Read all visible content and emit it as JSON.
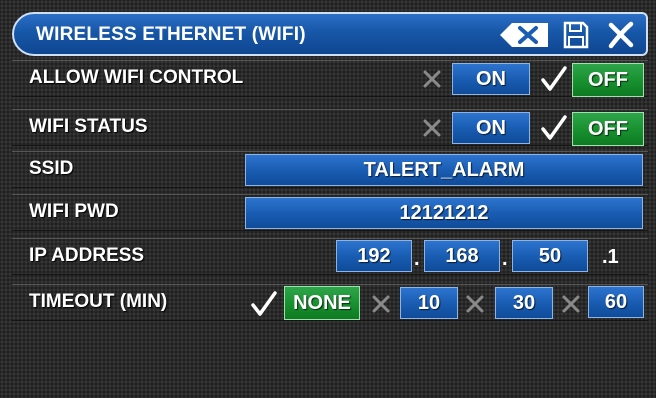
{
  "title": "WIRELESS ETHERNET (WIFI)",
  "toolbar": {
    "backspace_icon": "backspace-x-icon",
    "save_icon": "floppy-disk-icon",
    "close_icon": "close-x-icon"
  },
  "rows": {
    "allow_wifi_control": {
      "label": "ALLOW WIFI CONTROL",
      "on_label": "ON",
      "off_label": "OFF",
      "selected": "OFF"
    },
    "wifi_status": {
      "label": "WIFI STATUS",
      "on_label": "ON",
      "off_label": "OFF",
      "selected": "OFF"
    },
    "ssid": {
      "label": "SSID",
      "value": "TALERT_ALARM"
    },
    "wifi_pwd": {
      "label": "WIFI PWD",
      "value": "12121212"
    },
    "ip_address": {
      "label": "IP ADDRESS",
      "octet1": "192",
      "octet2": "168",
      "octet3": "50",
      "octet4": ".1",
      "separator": "."
    },
    "timeout": {
      "label": "TIMEOUT (MIN)",
      "options": [
        "NONE",
        "10",
        "30",
        "60"
      ],
      "selected": "NONE"
    }
  },
  "colors": {
    "blue_button": "#1a5db3",
    "green_button": "#18902f",
    "check_mark": "#ffffff",
    "unselected_x": "#8a8a8a"
  }
}
